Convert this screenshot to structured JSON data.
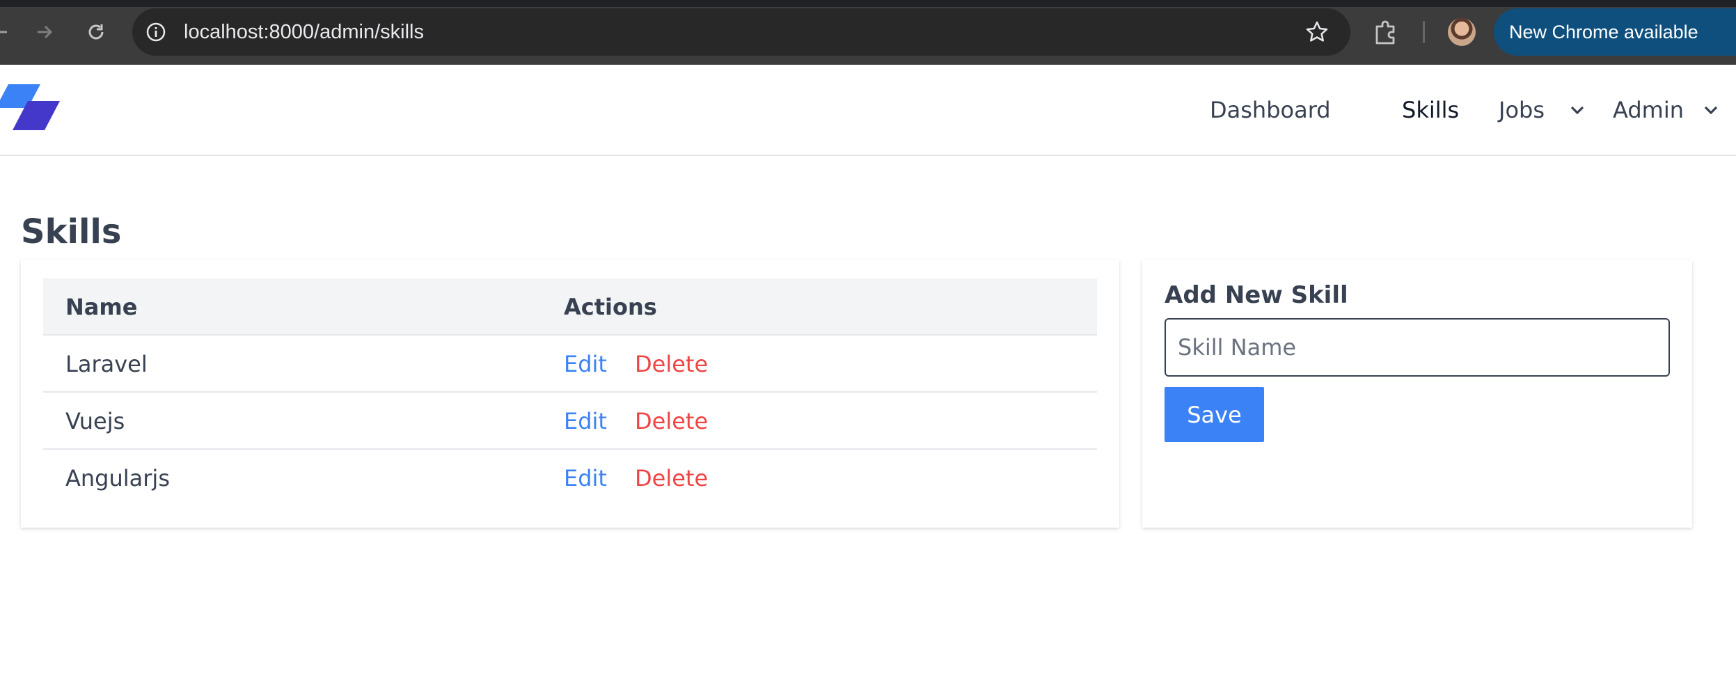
{
  "browser": {
    "url_host": "localhost",
    "url_path": ":8000/admin/skills",
    "update_button_label": "New Chrome available",
    "icons": [
      "back-icon",
      "forward-icon",
      "reload-icon",
      "info-icon",
      "star-icon",
      "extensions-icon",
      "profile-avatar",
      "more-vert-icon"
    ]
  },
  "nav": {
    "items": [
      {
        "label": "Dashboard"
      },
      {
        "label": "Skills"
      },
      {
        "label": "Jobs"
      },
      {
        "label": "Admin"
      }
    ]
  },
  "page": {
    "title": "Skills"
  },
  "table": {
    "headers": {
      "name": "Name",
      "actions": "Actions"
    },
    "rows": [
      {
        "name": "Laravel",
        "edit": "Edit",
        "delete": "Delete"
      },
      {
        "name": "Vuejs",
        "edit": "Edit",
        "delete": "Delete"
      },
      {
        "name": "Angularjs",
        "edit": "Edit",
        "delete": "Delete"
      }
    ]
  },
  "form": {
    "title": "Add New Skill",
    "input_placeholder": "Skill Name",
    "input_value": "",
    "save_label": "Save"
  },
  "colors": {
    "accent": "#3b82f6",
    "danger": "#ef4444",
    "text": "#374151",
    "chrome_update": "#0e4f7e",
    "logo_light": "#3b82f6",
    "logo_dark": "#4338ca"
  }
}
